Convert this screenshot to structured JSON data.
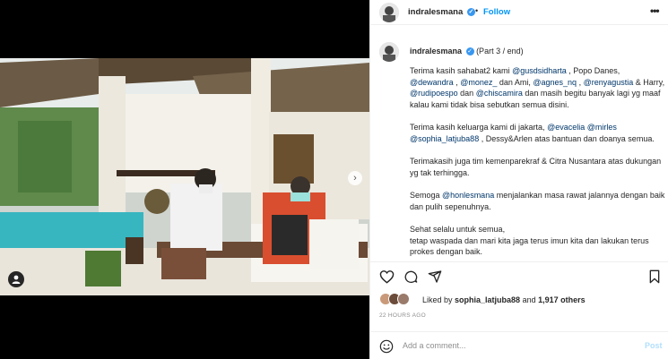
{
  "header": {
    "username": "indralesmana",
    "separator": "•",
    "follow_label": "Follow",
    "more_label": "•••"
  },
  "caption": {
    "username": "indralesmana",
    "part": "(Part 3 / end)",
    "p1": [
      {
        "t": "Terima kasih sahabat2 kami ",
        "m": false
      },
      {
        "t": "@gusdsidharta",
        "m": true
      },
      {
        "t": " , Popo Danes, ",
        "m": false
      },
      {
        "t": "@dewandra",
        "m": true
      },
      {
        "t": " , ",
        "m": false
      },
      {
        "t": "@monez_",
        "m": true
      },
      {
        "t": " dan Ami, ",
        "m": false
      },
      {
        "t": "@agnes_nq",
        "m": true
      },
      {
        "t": " , ",
        "m": false
      },
      {
        "t": "@renyagustia",
        "m": true
      },
      {
        "t": " & Harry, ",
        "m": false
      },
      {
        "t": "@rudipoespo",
        "m": true
      },
      {
        "t": " dan ",
        "m": false
      },
      {
        "t": "@chiscamira",
        "m": true
      },
      {
        "t": " dan masih begitu banyak lagi yg maaf kalau kami tidak bisa sebutkan semua disini.",
        "m": false
      }
    ],
    "p2": [
      {
        "t": "Terima kasih keluarga kami di jakarta, ",
        "m": false
      },
      {
        "t": "@evacelia",
        "m": true
      },
      {
        "t": " ",
        "m": false
      },
      {
        "t": "@mirles",
        "m": true
      },
      {
        "t": " ",
        "m": false
      },
      {
        "t": "@sophia_latjuba88",
        "m": true
      },
      {
        "t": " , Dessy&Arlen atas bantuan dan doanya semua.",
        "m": false
      }
    ],
    "p3": [
      {
        "t": "Terimakasih juga tim kemenparekraf & Citra Nusantara atas dukungan yg tak terhingga.",
        "m": false
      }
    ],
    "p4": [
      {
        "t": "Semoga ",
        "m": false
      },
      {
        "t": "@honlesmana",
        "m": true
      },
      {
        "t": " menjalankan masa rawat jalannya dengan baik dan pulih sepenuhnya.",
        "m": false
      }
    ],
    "p5_line1": "Sehat selalu untuk semua,",
    "p5_line2": "tetap waspada dan mari kita jaga terus imun kita dan lakukan terus prokes dengan baik."
  },
  "likes": {
    "prefix": "Liked by ",
    "user": "sophia_latjuba88",
    "middle": " and ",
    "others": "1,917 others"
  },
  "timestamp": "22 HOURS AGO",
  "comment": {
    "placeholder": "Add a comment...",
    "post_label": "Post"
  },
  "icons": {
    "like": "heart-icon",
    "comment": "comment-icon",
    "share": "share-icon",
    "save": "bookmark-icon",
    "emoji": "emoji-icon",
    "next": "chevron-right-icon",
    "tag": "user-tag-icon",
    "verified": "verified-badge-icon"
  },
  "colors": {
    "link": "#00376b",
    "follow": "#0095f6",
    "verified": "#3897f0",
    "post_disabled": "#b2dffc",
    "muted": "#8e8e8e"
  }
}
